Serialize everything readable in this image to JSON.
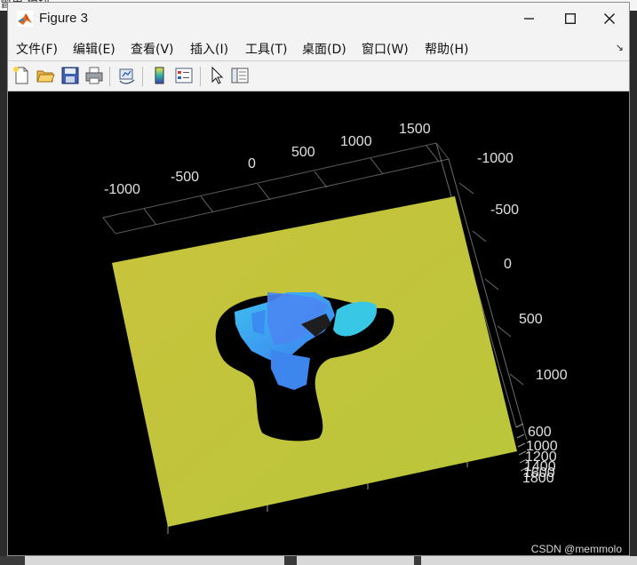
{
  "window": {
    "title": "Figure 3"
  },
  "menu": [
    {
      "label": "文件(F)"
    },
    {
      "label": "编辑(E)"
    },
    {
      "label": "查看(V)"
    },
    {
      "label": "插入(I)"
    },
    {
      "label": "工具(T)"
    },
    {
      "label": "桌面(D)"
    },
    {
      "label": "窗口(W)"
    },
    {
      "label": "帮助(H)"
    }
  ],
  "toolbar": {
    "icons": [
      "new-figure-icon",
      "open-file-icon",
      "save-icon",
      "print-icon",
      "link-plot-icon",
      "colorbar-icon",
      "legend-icon",
      "pointer-icon",
      "property-inspector-icon"
    ]
  },
  "axes": {
    "top_ticks": [
      "-1000",
      "-500",
      "0",
      "500",
      "1000",
      "1500"
    ],
    "right_ticks": [
      "-1000",
      "-500",
      "0",
      "500",
      "1000"
    ],
    "z_ticks": [
      "600",
      "1000",
      "1200",
      "1400",
      "1600",
      "1800"
    ]
  },
  "colors": {
    "background": "#000000",
    "surface": "#c8c83a",
    "object": "#3fa6f2"
  },
  "watermark": "CSDN @memmolo"
}
